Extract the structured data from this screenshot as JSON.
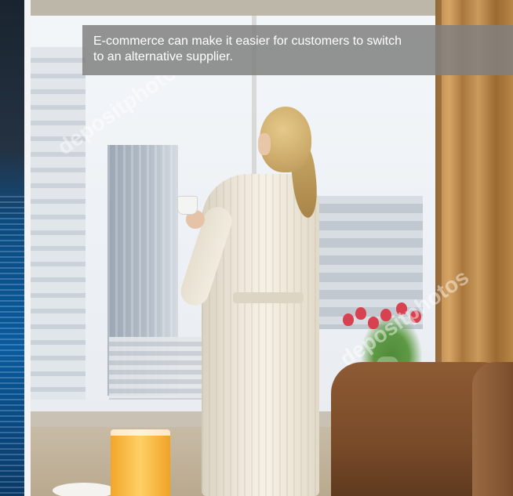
{
  "caption": {
    "text": "E-commerce can make it easier for customers to switch to an alternative supplier."
  },
  "watermark": {
    "text": "depositphotos"
  },
  "photo": {
    "subject": "woman-in-bathrobe-at-hotel-window"
  },
  "colors": {
    "caption_background": "#808080",
    "caption_text": "#ffffff",
    "curtain": "#b8874a",
    "robe": "#efe9dc"
  }
}
